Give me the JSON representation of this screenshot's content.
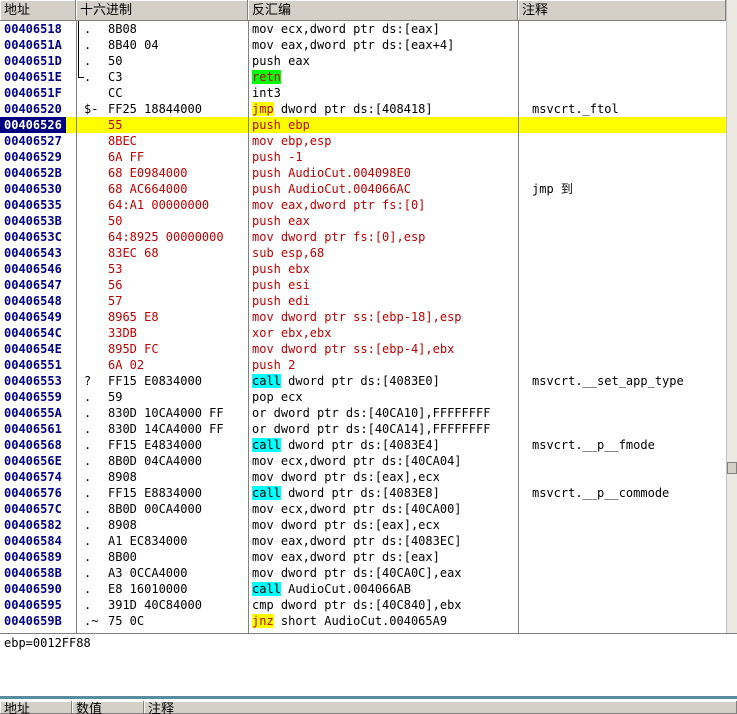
{
  "columns": {
    "addr": "地址",
    "hex": "十六进制",
    "disasm": "反汇编",
    "comment": "注释"
  },
  "rows": [
    {
      "addr": "00406518",
      "mark": ".",
      "hex": "8B08",
      "pre": "",
      "kw": "",
      "rest": "mov ecx,dword ptr ds:[eax]",
      "comment": "",
      "red": false
    },
    {
      "addr": "0040651A",
      "mark": ".",
      "hex": "8B40 04",
      "pre": "",
      "kw": "",
      "rest": "mov eax,dword ptr ds:[eax+4]",
      "comment": "",
      "red": false
    },
    {
      "addr": "0040651D",
      "mark": ".",
      "hex": "50",
      "pre": "",
      "kw": "",
      "rest": "push eax",
      "comment": "",
      "red": false
    },
    {
      "addr": "0040651E",
      "mark": ".",
      "hex": "C3",
      "pre": "",
      "kw": "retn",
      "kwtype": "ret",
      "rest": "",
      "comment": "",
      "red": false
    },
    {
      "addr": "0040651F",
      "mark": "",
      "hex": "CC",
      "pre": "",
      "kw": "",
      "rest": "int3",
      "comment": "",
      "red": false
    },
    {
      "addr": "00406520",
      "mark": "$-",
      "hex": "FF25 18844000",
      "pre": "",
      "kw": "jmp",
      "kwtype": "jmp",
      "rest": " dword ptr ds:[408418]",
      "comment": "msvcrt._ftol",
      "red": false
    },
    {
      "addr": "00406526",
      "mark": "",
      "hex": "55",
      "pre": "",
      "kw": "",
      "rest": "push ebp",
      "comment": "",
      "red": true,
      "sel": true,
      "cur": true
    },
    {
      "addr": "00406527",
      "mark": "",
      "hex": "8BEC",
      "pre": "",
      "kw": "",
      "rest": "mov ebp,esp",
      "comment": "",
      "red": true
    },
    {
      "addr": "00406529",
      "mark": "",
      "hex": "6A FF",
      "pre": "",
      "kw": "",
      "rest": "push -1",
      "comment": "",
      "red": true
    },
    {
      "addr": "0040652B",
      "mark": "",
      "hex": "68 E0984000",
      "pre": "",
      "kw": "",
      "rest": "push AudioCut.004098E0",
      "comment": "",
      "red": true
    },
    {
      "addr": "00406530",
      "mark": "",
      "hex": "68 AC664000",
      "pre": "",
      "kw": "",
      "rest": "push AudioCut.004066AC",
      "comment": "jmp 到",
      "red": true
    },
    {
      "addr": "00406535",
      "mark": "",
      "hex": "64:A1 00000000",
      "pre": "",
      "kw": "",
      "rest": "mov eax,dword ptr fs:[0]",
      "comment": "",
      "red": true
    },
    {
      "addr": "0040653B",
      "mark": "",
      "hex": "50",
      "pre": "",
      "kw": "",
      "rest": "push eax",
      "comment": "",
      "red": true
    },
    {
      "addr": "0040653C",
      "mark": "",
      "hex": "64:8925 00000000",
      "pre": "",
      "kw": "",
      "rest": "mov dword ptr fs:[0],esp",
      "comment": "",
      "red": true
    },
    {
      "addr": "00406543",
      "mark": "",
      "hex": "83EC 68",
      "pre": "",
      "kw": "",
      "rest": "sub esp,68",
      "comment": "",
      "red": true
    },
    {
      "addr": "00406546",
      "mark": "",
      "hex": "53",
      "pre": "",
      "kw": "",
      "rest": "push ebx",
      "comment": "",
      "red": true
    },
    {
      "addr": "00406547",
      "mark": "",
      "hex": "56",
      "pre": "",
      "kw": "",
      "rest": "push esi",
      "comment": "",
      "red": true
    },
    {
      "addr": "00406548",
      "mark": "",
      "hex": "57",
      "pre": "",
      "kw": "",
      "rest": "push edi",
      "comment": "",
      "red": true
    },
    {
      "addr": "00406549",
      "mark": "",
      "hex": "8965 E8",
      "pre": "",
      "kw": "",
      "rest": "mov dword ptr ss:[ebp-18],esp",
      "comment": "",
      "red": true
    },
    {
      "addr": "0040654C",
      "mark": "",
      "hex": "33DB",
      "pre": "",
      "kw": "",
      "rest": "xor ebx,ebx",
      "comment": "",
      "red": true
    },
    {
      "addr": "0040654E",
      "mark": "",
      "hex": "895D FC",
      "pre": "",
      "kw": "",
      "rest": "mov dword ptr ss:[ebp-4],ebx",
      "comment": "",
      "red": true
    },
    {
      "addr": "00406551",
      "mark": "",
      "hex": "6A 02",
      "pre": "",
      "kw": "",
      "rest": "push 2",
      "comment": "",
      "red": true
    },
    {
      "addr": "00406553",
      "mark": "?",
      "hex": "FF15 E0834000",
      "pre": "",
      "kw": "call",
      "kwtype": "call",
      "rest": " dword ptr ds:[4083E0]",
      "comment": "msvcrt.__set_app_type",
      "red": false
    },
    {
      "addr": "00406559",
      "mark": ".",
      "hex": "59",
      "pre": "",
      "kw": "",
      "rest": "pop ecx",
      "comment": "",
      "red": false
    },
    {
      "addr": "0040655A",
      "mark": ".",
      "hex": "830D 10CA4000 FF",
      "pre": "",
      "kw": "",
      "rest": "or dword ptr ds:[40CA10],FFFFFFFF",
      "comment": "",
      "red": false
    },
    {
      "addr": "00406561",
      "mark": ".",
      "hex": "830D 14CA4000 FF",
      "pre": "",
      "kw": "",
      "rest": "or dword ptr ds:[40CA14],FFFFFFFF",
      "comment": "",
      "red": false
    },
    {
      "addr": "00406568",
      "mark": ".",
      "hex": "FF15 E4834000",
      "pre": "",
      "kw": "call",
      "kwtype": "call",
      "rest": " dword ptr ds:[4083E4]",
      "comment": "msvcrt.__p__fmode",
      "red": false
    },
    {
      "addr": "0040656E",
      "mark": ".",
      "hex": "8B0D 04CA4000",
      "pre": "",
      "kw": "",
      "rest": "mov ecx,dword ptr ds:[40CA04]",
      "comment": "",
      "red": false
    },
    {
      "addr": "00406574",
      "mark": ".",
      "hex": "8908",
      "pre": "",
      "kw": "",
      "rest": "mov dword ptr ds:[eax],ecx",
      "comment": "",
      "red": false
    },
    {
      "addr": "00406576",
      "mark": ".",
      "hex": "FF15 E8834000",
      "pre": "",
      "kw": "call",
      "kwtype": "call",
      "rest": " dword ptr ds:[4083E8]",
      "comment": "msvcrt.__p__commode",
      "red": false
    },
    {
      "addr": "0040657C",
      "mark": ".",
      "hex": "8B0D 00CA4000",
      "pre": "",
      "kw": "",
      "rest": "mov ecx,dword ptr ds:[40CA00]",
      "comment": "",
      "red": false
    },
    {
      "addr": "00406582",
      "mark": ".",
      "hex": "8908",
      "pre": "",
      "kw": "",
      "rest": "mov dword ptr ds:[eax],ecx",
      "comment": "",
      "red": false
    },
    {
      "addr": "00406584",
      "mark": ".",
      "hex": "A1 EC834000",
      "pre": "",
      "kw": "",
      "rest": "mov eax,dword ptr ds:[4083EC]",
      "comment": "",
      "red": false
    },
    {
      "addr": "00406589",
      "mark": ".",
      "hex": "8B00",
      "pre": "",
      "kw": "",
      "rest": "mov eax,dword ptr ds:[eax]",
      "comment": "",
      "red": false
    },
    {
      "addr": "0040658B",
      "mark": ".",
      "hex": "A3 0CCA4000",
      "pre": "",
      "kw": "",
      "rest": "mov dword ptr ds:[40CA0C],eax",
      "comment": "",
      "red": false
    },
    {
      "addr": "00406590",
      "mark": ".",
      "hex": "E8 16010000",
      "pre": "",
      "kw": "call",
      "kwtype": "call",
      "rest": " AudioCut.004066AB",
      "comment": "",
      "red": false
    },
    {
      "addr": "00406595",
      "mark": ".",
      "hex": "391D 40C84000",
      "pre": "",
      "kw": "",
      "rest": "cmp dword ptr ds:[40C840],ebx",
      "comment": "",
      "red": false
    },
    {
      "addr": "0040659B",
      "mark": ".~",
      "hex": "75 0C",
      "pre": "",
      "kw": "jnz",
      "kwtype": "jmp",
      "rest": " short AudioCut.004065A9",
      "comment": "",
      "red": false
    }
  ],
  "info_text": "ebp=0012FF88",
  "dump_columns": {
    "addr": "地址",
    "value": "数值",
    "comment": "注释"
  },
  "colors": {
    "selection": "#ffff00",
    "call_bg": "#00ffff",
    "red_text": "#c00000",
    "current_addr_bg": "#000080",
    "ret_bg": "#00ff00"
  }
}
